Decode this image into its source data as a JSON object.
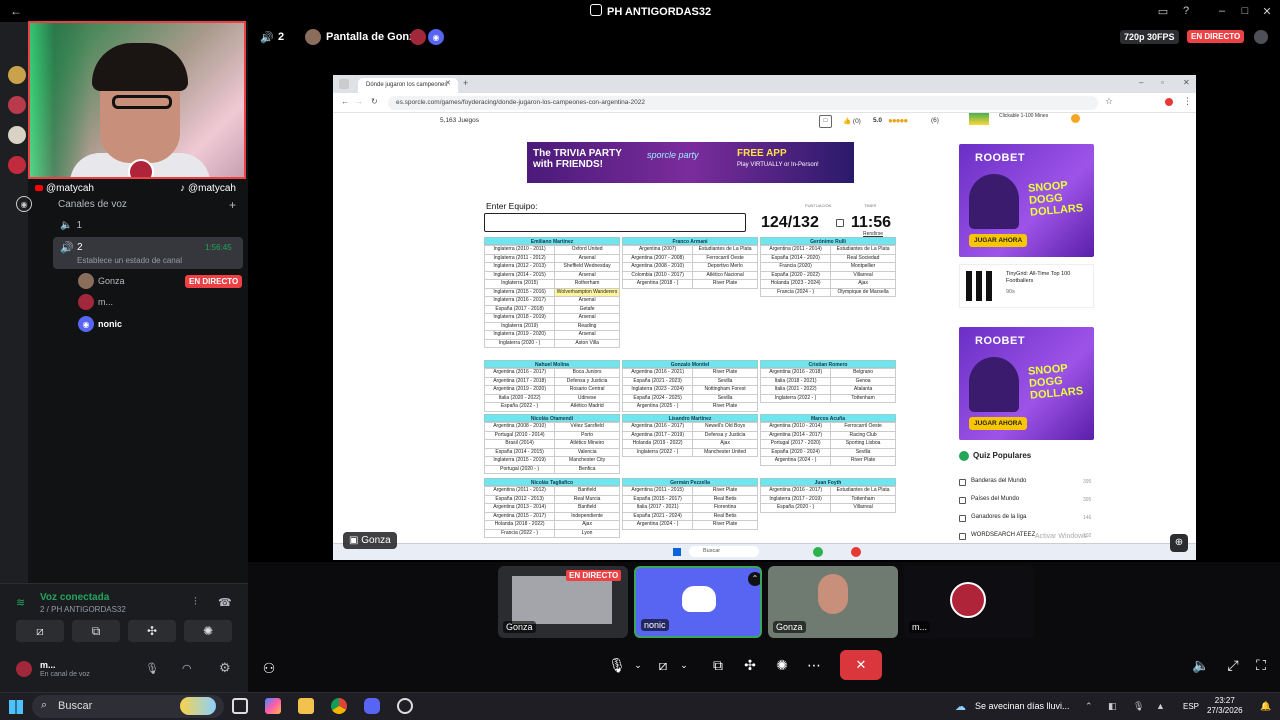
{
  "window": {
    "title": "PH ANTIGORDAS32"
  },
  "stream": {
    "viewer_count": "2",
    "screen_title": "Pantalla de Gonza",
    "quality": "720p 30FPS",
    "live_label": "EN DIRECTO"
  },
  "webcam": {
    "handle_left": "@matycah",
    "handle_right": "@matycah"
  },
  "sidebar": {
    "section_title": "Canales de voz",
    "channel_1": "1",
    "channel_2": "2",
    "channel_2_time": "1:56:45",
    "status_prompt": "Establece un estado de canal",
    "members": [
      {
        "name": "Gonza",
        "badge": "EN DIRECTO"
      },
      {
        "name": "m..."
      },
      {
        "name": "nonic"
      }
    ]
  },
  "voice_panel": {
    "status": "Voz conectada",
    "location": "2 / PH ANTIGORDAS32",
    "user_name": "m...",
    "user_status": "En canal de voz"
  },
  "browser": {
    "tab_title": "Dónde jugaron los campeones",
    "url": "es.sporcle.com/games/foyderacing/donde-jugaron-los-campeones-con-argentina-2022",
    "games_count": "5,163 Juegos",
    "rating": "5.0",
    "rating_count": "(6)",
    "likes": "(0)"
  },
  "ad": {
    "line1": "The TRIVIA PARTY",
    "line2": "with FRIENDS!",
    "brand": "sporcle party",
    "app": "FREE APP",
    "sub": "Play VIRTUALLY or In-Person!"
  },
  "quiz": {
    "enter_label": "Enter Equipo:",
    "score_label": "PUNTUACIÓN",
    "score": "124/132",
    "timer_label": "TIMER",
    "timer": "11:56",
    "give_up": "Rendirse"
  },
  "players": [
    {
      "name": "Emiliano Martínez",
      "rows": [
        [
          "Inglaterra (2010 - 2011)",
          "Oxford United"
        ],
        [
          "Inglaterra (2011 - 2012)",
          "Arsenal"
        ],
        [
          "Inglaterra (2012 - 2013)",
          "Sheffield Wednesday"
        ],
        [
          "Inglaterra (2014 - 2015)",
          "Arsenal"
        ],
        [
          "Inglaterra (2015)",
          "Rotherham"
        ],
        [
          "Inglaterra (2015 - 2016)",
          "Wolverhampton Wanderers"
        ],
        [
          "Inglaterra (2016 - 2017)",
          "Arsenal"
        ],
        [
          "España (2017 - 2018)",
          "Getafe"
        ],
        [
          "Inglaterra (2018 - 2019)",
          "Arsenal"
        ],
        [
          "Inglaterra (2019)",
          "Reading"
        ],
        [
          "Inglaterra (2019 - 2020)",
          "Arsenal"
        ],
        [
          "Inglaterra (2020 - )",
          "Aston Villa"
        ]
      ]
    },
    {
      "name": "Franco Armani",
      "rows": [
        [
          "Argentina (2007)",
          "Estudiantes de La Plata"
        ],
        [
          "Argentina (2007 - 2008)",
          "Ferrocarril Oeste"
        ],
        [
          "Argentina (2008 - 2010)",
          "Deportivo Merlo"
        ],
        [
          "Colombia (2010 - 2017)",
          "Atlético Nacional"
        ],
        [
          "Argentina (2018 - )",
          "River Plate"
        ]
      ]
    },
    {
      "name": "Gerónimo Rulli",
      "rows": [
        [
          "Argentina (2011 - 2014)",
          "Estudiantes de La Plata"
        ],
        [
          "España (2014 - 2020)",
          "Real Sociedad"
        ],
        [
          "Francia (2020)",
          "Montpellier"
        ],
        [
          "España (2020 - 2022)",
          "Villarreal"
        ],
        [
          "Holanda (2023 - 2024)",
          "Ajax"
        ],
        [
          "Francia (2024 - )",
          "Olympique de Marsella"
        ]
      ]
    },
    {
      "name": "Nahuel Molina",
      "rows": [
        [
          "Argentina (2016 - 2017)",
          "Boca Juniors"
        ],
        [
          "Argentina (2017 - 2018)",
          "Defensa y Justicia"
        ],
        [
          "Argentina (2019 - 2020)",
          "Rosario Central"
        ],
        [
          "Italia (2020 - 2022)",
          "Udinese"
        ],
        [
          "España (2022 - )",
          "Atlético Madrid"
        ]
      ]
    },
    {
      "name": "Gonzalo Montiel",
      "rows": [
        [
          "Argentina (2016 - 2021)",
          "River Plate"
        ],
        [
          "España (2021 - 2023)",
          "Sevilla"
        ],
        [
          "Inglaterra (2023 - 2024)",
          "Nottingham Forest"
        ],
        [
          "España (2024 - 2025)",
          "Sevilla"
        ],
        [
          "Argentina (2025 - )",
          "River Plate"
        ]
      ]
    },
    {
      "name": "Cristian Romero",
      "rows": [
        [
          "Argentina (2016 - 2018)",
          "Belgrano"
        ],
        [
          "Italia (2018 - 2021)",
          "Genoa"
        ],
        [
          "Italia (2021 - 2022)",
          "Atalanta"
        ],
        [
          "Inglaterra (2022 - )",
          "Tottenham"
        ]
      ]
    },
    {
      "name": "Nicolás Otamendi",
      "rows": [
        [
          "Argentina (2008 - 2010)",
          "Vélez Sarsfield"
        ],
        [
          "Portugal (2010 - 2014)",
          "Porto"
        ],
        [
          "Brasil (2014)",
          "Atlético Mineiro"
        ],
        [
          "España (2014 - 2015)",
          "Valencia"
        ],
        [
          "Inglaterra (2015 - 2019)",
          "Manchester City"
        ],
        [
          "Portugal (2020 - )",
          "Benfica"
        ]
      ]
    },
    {
      "name": "Lisandro Martínez",
      "rows": [
        [
          "Argentina (2016 - 2017)",
          "Newell's Old Boys"
        ],
        [
          "Argentina (2017 - 2019)",
          "Defensa y Justicia"
        ],
        [
          "Holanda (2019 - 2022)",
          "Ajax"
        ],
        [
          "Inglaterra (2022 - )",
          "Manchester United"
        ]
      ]
    },
    {
      "name": "Marcos Acuña",
      "rows": [
        [
          "Argentina (2010 - 2014)",
          "Ferrocarril Oeste"
        ],
        [
          "Argentina (2014 - 2017)",
          "Racing Club"
        ],
        [
          "Portugal (2017 - 2020)",
          "Sporting Lisboa"
        ],
        [
          "España (2020 - 2024)",
          "Sevilla"
        ],
        [
          "Argentina (2024 - )",
          "River Plate"
        ]
      ]
    },
    {
      "name": "Nicolás Tagliafico",
      "rows": [
        [
          "Argentina (2011 - 2012)",
          "Banfield"
        ],
        [
          "España (2012 - 2013)",
          "Real Murcia"
        ],
        [
          "Argentina (2013 - 2014)",
          "Banfield"
        ],
        [
          "Argentina (2015 - 2017)",
          "Independiente"
        ],
        [
          "Holanda (2018 - 2022)",
          "Ajax"
        ],
        [
          "Francia (2022 - )",
          "Lyon"
        ]
      ]
    },
    {
      "name": "Germán Pezzella",
      "rows": [
        [
          "Argentina (2011 - 2015)",
          "River Plate"
        ],
        [
          "España (2015 - 2017)",
          "Real Betis"
        ],
        [
          "Italia (2017 - 2021)",
          "Fiorentina"
        ],
        [
          "España (2021 - 2024)",
          "Real Betis"
        ],
        [
          "Argentina (2024 - )",
          "River Plate"
        ]
      ]
    },
    {
      "name": "Juan Foyth",
      "rows": [
        [
          "Argentina (2016 - 2017)",
          "Estudiantes de La Plata"
        ],
        [
          "Inglaterra (2017 - 2019)",
          "Tottenham"
        ],
        [
          "España (2020 - )",
          "Villarreal"
        ]
      ]
    }
  ],
  "sidebar_ads": {
    "top_item": "Clickable 1-100 Mines",
    "roobet_brand": "ROOBET",
    "roobet_promo": "SNOOP DOGG DOLLARS",
    "roobet_cta": "JUGAR AHORA",
    "tinygrid_title": "TinyGrid: All-Time Top 100 Footballers",
    "tinygrid_sub": "90s"
  },
  "popular": {
    "title": "Quiz Populares",
    "items": [
      {
        "label": "Banderas del Mundo",
        "n": "395"
      },
      {
        "label": "Países del Mundo",
        "n": "395"
      },
      {
        "label": "Ganadores de la liga",
        "n": "146"
      },
      {
        "label": "WORDSEARCH ATEEZ",
        "n": "102"
      }
    ]
  },
  "activate_windows": "Activar Windows",
  "inner_taskbar": {
    "search": "Buscar"
  },
  "tiles": [
    {
      "name": "Gonza",
      "badge": "EN DIRECTO"
    },
    {
      "name": "nonic"
    },
    {
      "name": "Gonza"
    },
    {
      "name": "m..."
    }
  ],
  "stage_label": "Gonza",
  "taskbar": {
    "search": "Buscar",
    "weather": "Se avecinan días lluvi...",
    "lang": "ESP",
    "time": "23:27",
    "date": "27/3/2026"
  },
  "colors": {
    "discord_blurple": "#5865f2",
    "live_red": "#ed4245",
    "quiz_header": "#6fe6ef"
  }
}
